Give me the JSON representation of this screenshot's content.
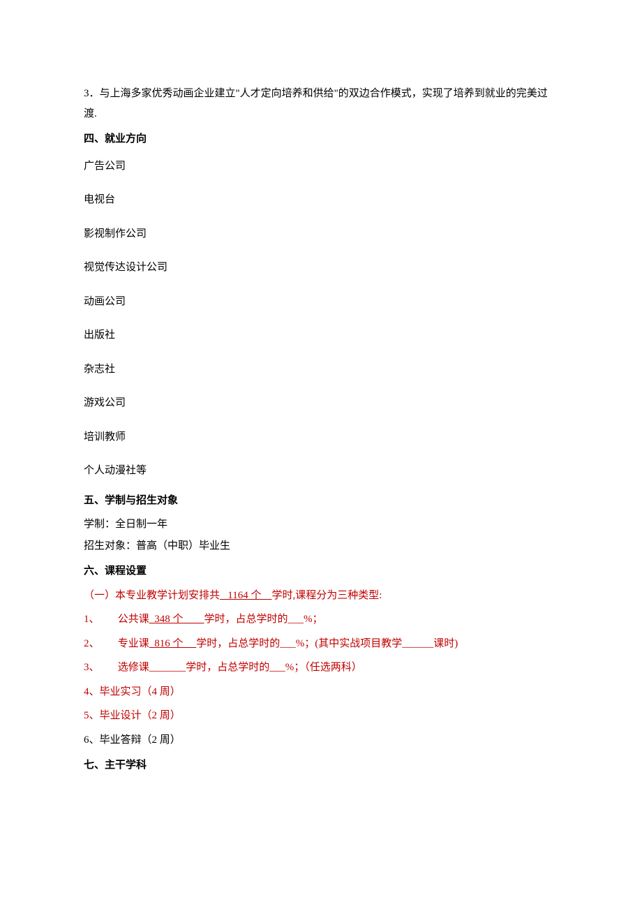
{
  "intro": {
    "item3": "3．与上海多家优秀动画企业建立\"人才定向培养和供给\"的双边合作模式，实现了培养到就业的完美过渡."
  },
  "section4": {
    "heading": "四、就业方向",
    "items": [
      "广告公司",
      "电视台",
      "影视制作公司",
      "视觉传达设计公司",
      "动画公司",
      "出版社",
      "杂志社",
      "游戏公司",
      "培训教师",
      "个人动漫社等"
    ]
  },
  "section5": {
    "heading": "五、学制与招生对象",
    "line1": "学制：全日制一年",
    "line2": "招生对象：普高（中职）毕业生"
  },
  "section6": {
    "heading": "六、课程设置",
    "line1_pre": "（一）本专业教学计划安排共",
    "line1_u1": "   1164 个    ",
    "line1_post": "学时,课程分为三种类型:",
    "item1_pre": "1、       公共课",
    "item1_u": "  348 个        ",
    "item1_post": "学时，占总学时的___%；",
    "item2_pre": "2、       专业课",
    "item2_u": "  816 个     ",
    "item2_post": "学时，占总学时的___%；(其中实战项目教学______课时)",
    "item3": "3、       选修课_______学时，占总学时的___%；（任选两科）",
    "item4": "4、毕业实习（4 周）",
    "item5": "5、毕业设计（2 周）",
    "item6": "6、毕业答辩（2 周）"
  },
  "section7": {
    "heading": "七、主干学科"
  }
}
